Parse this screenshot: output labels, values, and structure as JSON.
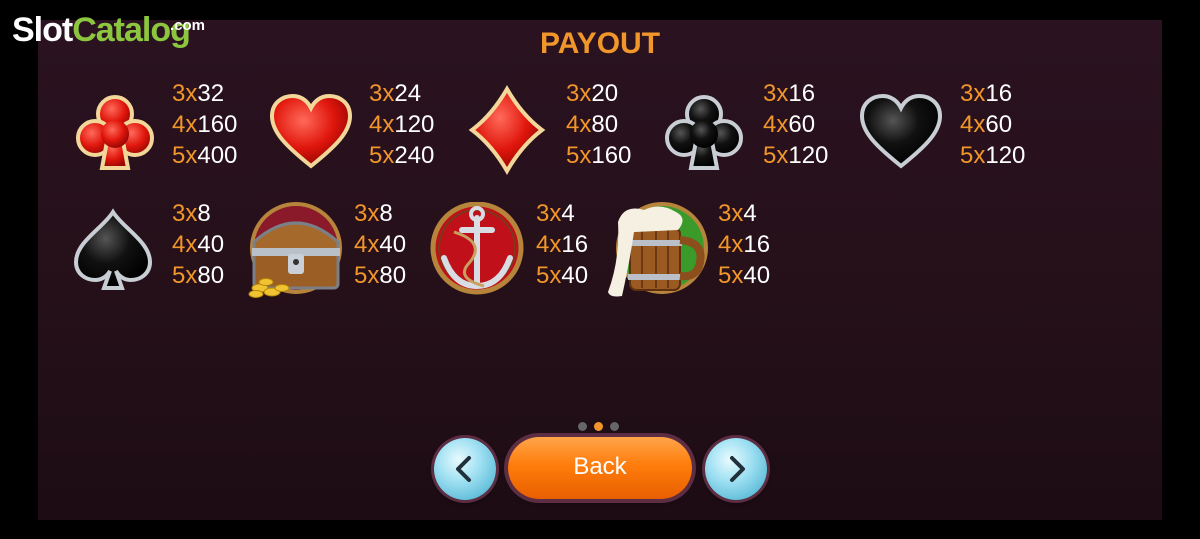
{
  "logo": {
    "part1": "Slot",
    "part2": "Catalog",
    "suffix": ".com"
  },
  "title": "PAYOUT",
  "symbols": [
    {
      "name": "red-club",
      "pays": [
        [
          "3x",
          "32"
        ],
        [
          "4x",
          "160"
        ],
        [
          "5x",
          "400"
        ]
      ]
    },
    {
      "name": "red-heart",
      "pays": [
        [
          "3x",
          "24"
        ],
        [
          "4x",
          "120"
        ],
        [
          "5x",
          "240"
        ]
      ]
    },
    {
      "name": "red-diamond",
      "pays": [
        [
          "3x",
          "20"
        ],
        [
          "4x",
          "80"
        ],
        [
          "5x",
          "160"
        ]
      ]
    },
    {
      "name": "black-club",
      "pays": [
        [
          "3x",
          "16"
        ],
        [
          "4x",
          "60"
        ],
        [
          "5x",
          "120"
        ]
      ]
    },
    {
      "name": "black-heart",
      "pays": [
        [
          "3x",
          "16"
        ],
        [
          "4x",
          "60"
        ],
        [
          "5x",
          "120"
        ]
      ]
    },
    {
      "name": "black-spade",
      "pays": [
        [
          "3x",
          "8"
        ],
        [
          "4x",
          "40"
        ],
        [
          "5x",
          "80"
        ]
      ]
    },
    {
      "name": "treasure-chest",
      "pays": [
        [
          "3x",
          "8"
        ],
        [
          "4x",
          "40"
        ],
        [
          "5x",
          "80"
        ]
      ]
    },
    {
      "name": "anchor",
      "pays": [
        [
          "3x",
          "4"
        ],
        [
          "4x",
          "16"
        ],
        [
          "5x",
          "40"
        ]
      ]
    },
    {
      "name": "beer-mug",
      "pays": [
        [
          "3x",
          "4"
        ],
        [
          "4x",
          "16"
        ],
        [
          "5x",
          "40"
        ]
      ]
    }
  ],
  "pagination": {
    "total": 3,
    "active": 2
  },
  "buttons": {
    "back": "Back",
    "prev_icon": "chevron-left-icon",
    "next_icon": "chevron-right-icon"
  },
  "colors": {
    "accent": "#f0962a",
    "back_button": "#ff7d0c",
    "nav_button": "#9fe0f2",
    "panel": "#2a1220"
  }
}
